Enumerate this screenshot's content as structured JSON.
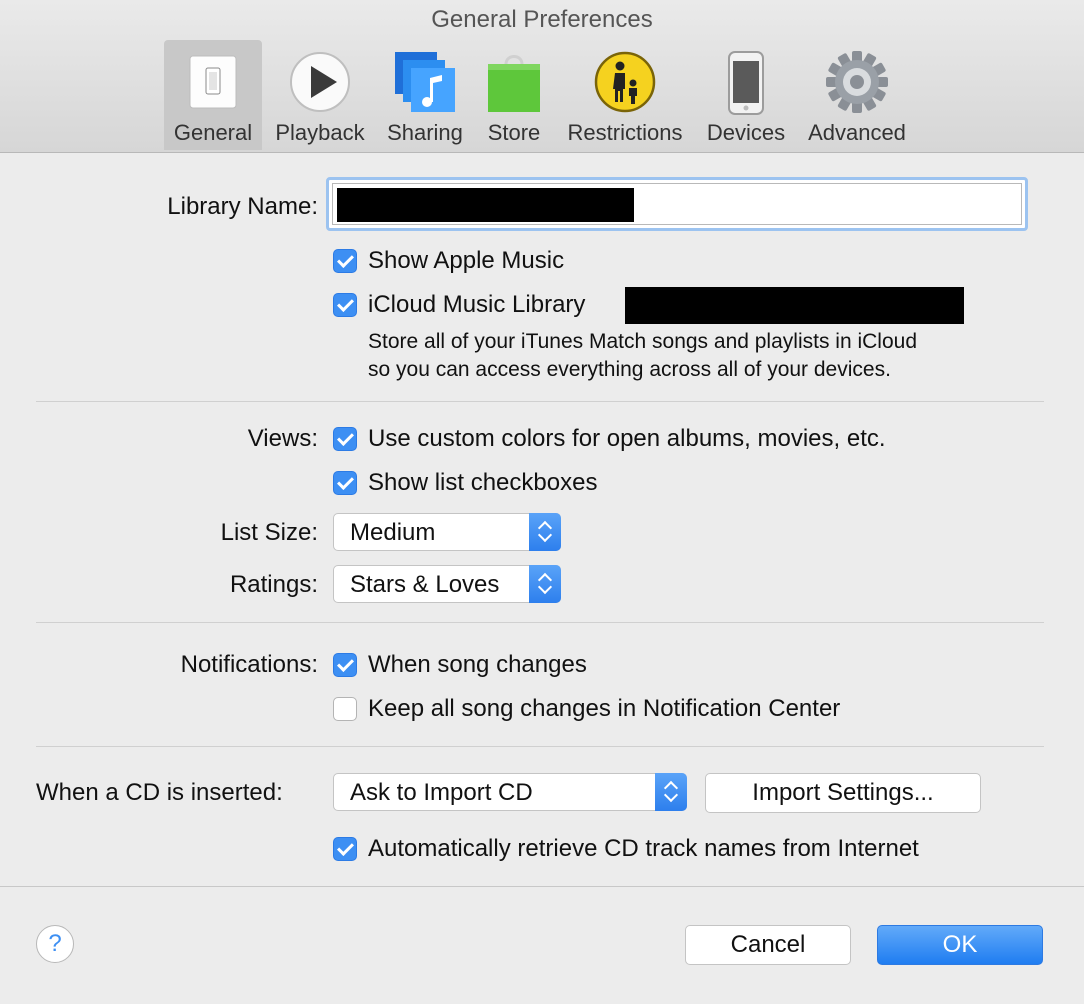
{
  "window": {
    "title": "General Preferences"
  },
  "tabs": [
    {
      "label": "General",
      "icon": "switch-icon",
      "selected": true
    },
    {
      "label": "Playback",
      "icon": "play-icon",
      "selected": false
    },
    {
      "label": "Sharing",
      "icon": "sharing-icon",
      "selected": false
    },
    {
      "label": "Store",
      "icon": "shopping-bag-icon",
      "selected": false
    },
    {
      "label": "Restrictions",
      "icon": "parental-controls-icon",
      "selected": false
    },
    {
      "label": "Devices",
      "icon": "phone-icon",
      "selected": false
    },
    {
      "label": "Advanced",
      "icon": "gear-icon",
      "selected": false
    }
  ],
  "library": {
    "label": "Library Name:",
    "value": ""
  },
  "show_apple_music": {
    "label": "Show Apple Music",
    "checked": true
  },
  "icloud": {
    "label": "iCloud Music Library",
    "checked": true,
    "description_line1": "Store all of your iTunes Match songs and playlists in iCloud",
    "description_line2": "so you can access everything across all of your devices."
  },
  "views": {
    "label": "Views:",
    "custom_colors": {
      "label": "Use custom colors for open albums, movies, etc.",
      "checked": true
    },
    "list_checkboxes": {
      "label": "Show list checkboxes",
      "checked": true
    }
  },
  "list_size": {
    "label": "List Size:",
    "value": "Medium"
  },
  "ratings": {
    "label": "Ratings:",
    "value": "Stars & Loves"
  },
  "notifications": {
    "label": "Notifications:",
    "song_changes": {
      "label": "When song changes",
      "checked": true
    },
    "keep_all": {
      "label": "Keep all song changes in Notification Center",
      "checked": false
    }
  },
  "cd": {
    "label": "When a CD is inserted:",
    "action": "Ask to Import CD",
    "import_settings": "Import Settings...",
    "auto_retrieve": {
      "label": "Automatically retrieve CD track names from Internet",
      "checked": true
    }
  },
  "footer": {
    "help": "?",
    "cancel": "Cancel",
    "ok": "OK"
  },
  "colors": {
    "accent": "#3d8ff3",
    "background": "#ececec",
    "store_green": "#5ec73b",
    "sharing_blue": "#2c8ef0",
    "restrictions_yellow": "#f5d21f"
  }
}
